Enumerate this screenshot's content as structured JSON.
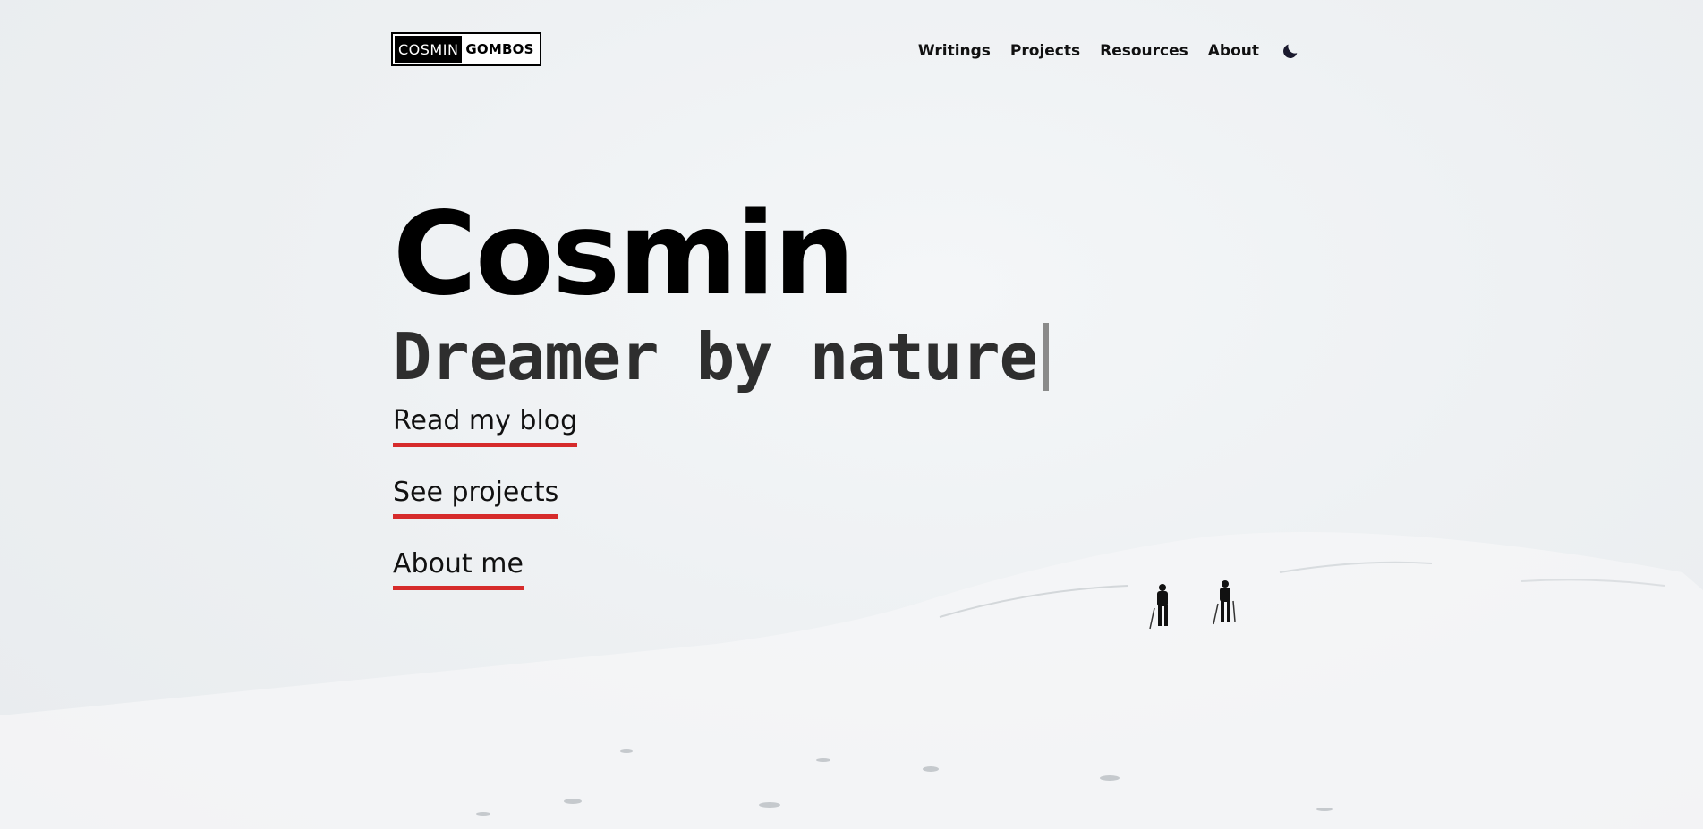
{
  "logo": {
    "part_a": "COSMIN",
    "part_b": "GOMBOS"
  },
  "nav": {
    "items": [
      {
        "label": "Writings"
      },
      {
        "label": "Projects"
      },
      {
        "label": "Resources"
      },
      {
        "label": "About"
      }
    ],
    "theme_icon": "moon-icon"
  },
  "hero": {
    "name": "Cosmin",
    "tagline": "Dreamer by nature",
    "links": [
      {
        "label": "Read my blog"
      },
      {
        "label": "See projects"
      },
      {
        "label": "About me"
      }
    ]
  },
  "colors": {
    "accent": "#d62b2b",
    "text": "#111111",
    "background": "#eef1f3"
  }
}
